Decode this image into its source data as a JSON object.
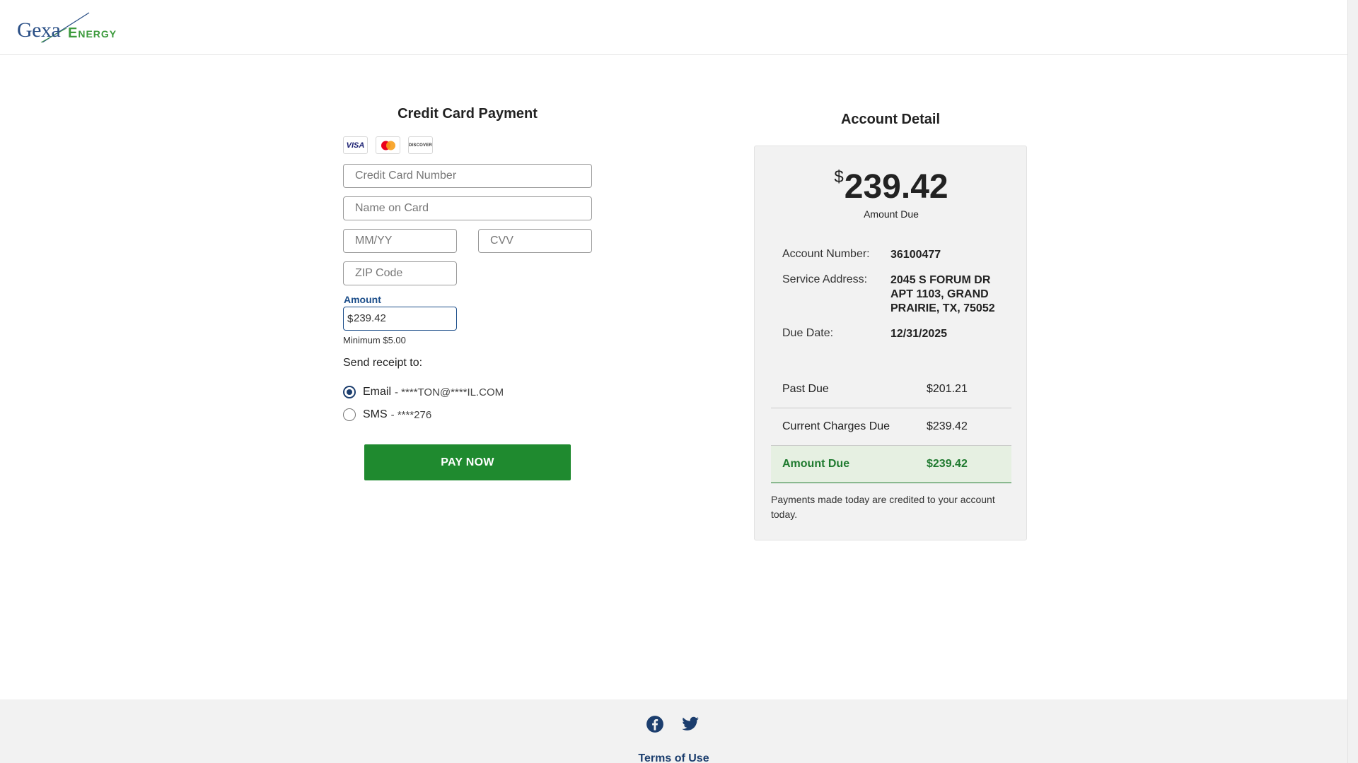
{
  "brand": {
    "name_part1": "Gexa",
    "name_part2": "Energy",
    "colors": {
      "blue": "#2a4f86",
      "green": "#3c9a3c",
      "pay_green": "#1f8a2f",
      "navy": "#1c3e6e"
    }
  },
  "payment": {
    "title": "Credit Card Payment",
    "card_logos": [
      "VISA",
      "mastercard",
      "DISCOVER"
    ],
    "fields": {
      "card_number_placeholder": "Credit Card Number",
      "name_placeholder": "Name on Card",
      "expiry_placeholder": "MM/YY",
      "cvv_placeholder": "CVV",
      "zip_placeholder": "ZIP Code"
    },
    "amount_label": "Amount",
    "amount_symbol": "$",
    "amount_value": "239.42",
    "minimum_text": "Minimum $5.00",
    "receipt_label": "Send receipt to:",
    "receipt_options": [
      {
        "label": "Email",
        "masked": "- ****TON@****IL.COM",
        "selected": true
      },
      {
        "label": "SMS",
        "masked": "- ****276",
        "selected": false
      }
    ],
    "pay_button": "PAY NOW"
  },
  "account": {
    "title": "Account Detail",
    "amount_symbol": "$",
    "amount_due_big": "239.42",
    "amount_due_caption": "Amount Due",
    "account_number_label": "Account Number:",
    "account_number": "36100477",
    "service_address_label": "Service Address:",
    "service_address": "2045 S FORUM DR APT 1103, GRAND PRAIRIE, TX, 75052",
    "due_date_label": "Due Date:",
    "due_date": "12/31/2025",
    "rows": [
      {
        "label": "Past Due",
        "value": "$201.21"
      },
      {
        "label": "Current Charges Due",
        "value": "$239.42"
      },
      {
        "label": "Amount Due",
        "value": "$239.42"
      }
    ],
    "note": "Payments made today are credited to your account today."
  },
  "footer": {
    "icons": [
      "facebook-icon",
      "twitter-icon"
    ],
    "terms_link": "Terms of Use"
  }
}
